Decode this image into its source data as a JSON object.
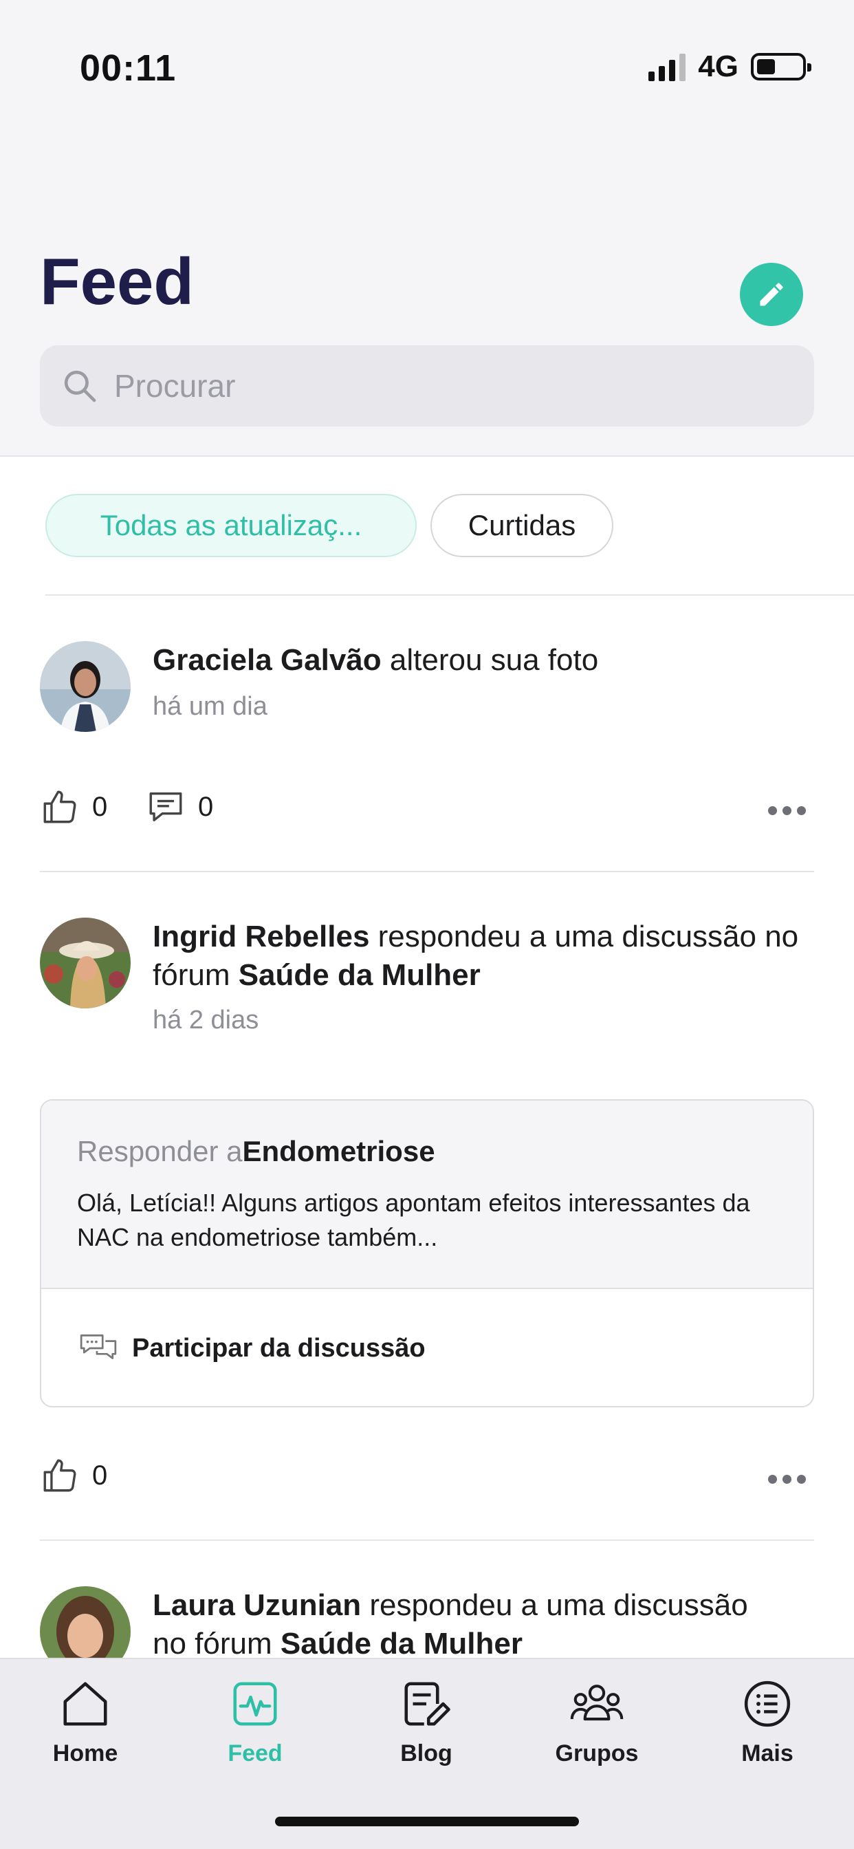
{
  "status_bar": {
    "time": "00:11",
    "network": "4G",
    "battery_icon": "battery-low-icon",
    "signal_icon": "signal-icon"
  },
  "header": {
    "title": "Feed",
    "compose_icon": "pencil-icon"
  },
  "search": {
    "placeholder": "Procurar",
    "icon": "search-icon"
  },
  "filters": [
    {
      "label": "Todas as atualizaç...",
      "active": true
    },
    {
      "label": "Curtidas",
      "active": false
    }
  ],
  "posts": [
    {
      "author": "Graciela Galvão",
      "action": " alterou sua foto",
      "time": "há um dia",
      "likes": "0",
      "comments": "0"
    },
    {
      "author": "Ingrid Rebelles",
      "action": " respondeu a uma discussão no fórum ",
      "forum": "Saúde da Mulher",
      "time": "há 2 dias",
      "reply": {
        "prefix": "Responder a",
        "topic": "Endometriose",
        "excerpt": "Olá, Letícia!! Alguns artigos apontam efeitos interessantes da NAC na endometriose também...",
        "join_label": "Participar da discussão"
      },
      "likes": "0"
    },
    {
      "author": "Laura Uzunian",
      "action": " respondeu a uma discussão",
      "line2_prefix": "no fórum ",
      "forum": "Saúde da Mulher"
    }
  ],
  "tabbar": [
    {
      "label": "Home",
      "icon": "home-icon",
      "active": false
    },
    {
      "label": "Feed",
      "icon": "activity-icon",
      "active": true
    },
    {
      "label": "Blog",
      "icon": "blog-edit-icon",
      "active": false
    },
    {
      "label": "Grupos",
      "icon": "group-icon",
      "active": false
    },
    {
      "label": "Mais",
      "icon": "menu-list-icon",
      "active": false
    }
  ],
  "colors": {
    "accent": "#31c4a9",
    "title": "#1f1d4a",
    "muted": "#8e8e96"
  }
}
